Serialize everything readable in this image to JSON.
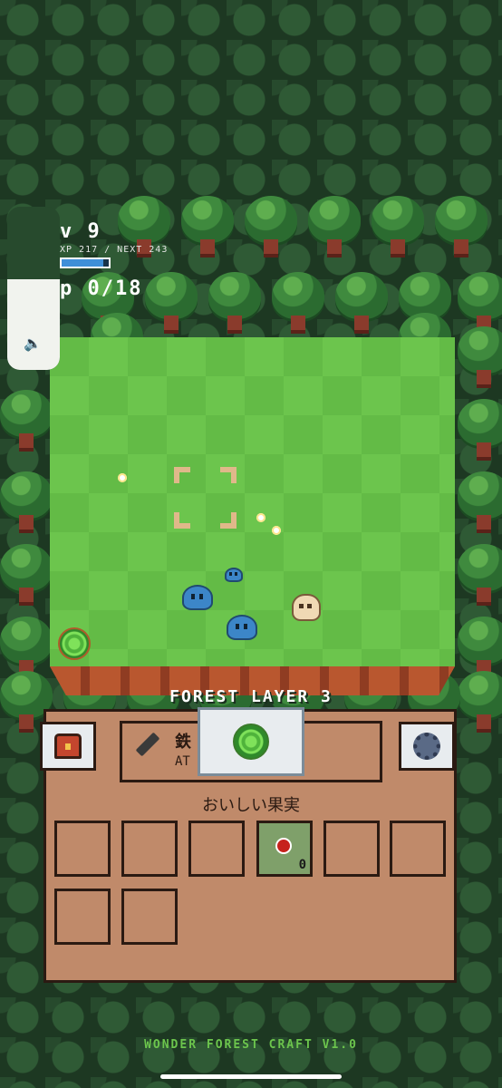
{
  "hud": {
    "level_label": "v 9",
    "exp_label": "XP 217 / NEXT 243",
    "exp_progress": 0.89,
    "hp_label": "p 0/18",
    "volume_level": 0.55
  },
  "stage": {
    "layer_title": "FOREST LAYER 3"
  },
  "toolbar": {
    "inventory_icon": "chest-icon",
    "settings_icon": "gear-icon",
    "selected_item_icon": "portal-icon"
  },
  "weapon": {
    "name": "鉄",
    "attack_label": "AT",
    "icon": "sword-icon"
  },
  "inventory": {
    "category_label": "おいしい果実",
    "slots": [
      {
        "item": "",
        "count": ""
      },
      {
        "item": "",
        "count": ""
      },
      {
        "item": "",
        "count": ""
      },
      {
        "item": "berry",
        "count": "0"
      },
      {
        "item": "",
        "count": ""
      },
      {
        "item": "",
        "count": ""
      },
      {
        "item": "",
        "count": ""
      },
      {
        "item": "",
        "count": ""
      }
    ]
  },
  "footer": {
    "version_label": "WONDER FOREST CRAFT V1.0"
  },
  "colors": {
    "grass": "#6cc54d",
    "panel": "#c08a6a",
    "slime": "#3c86c8",
    "forest": "#1d3822"
  }
}
